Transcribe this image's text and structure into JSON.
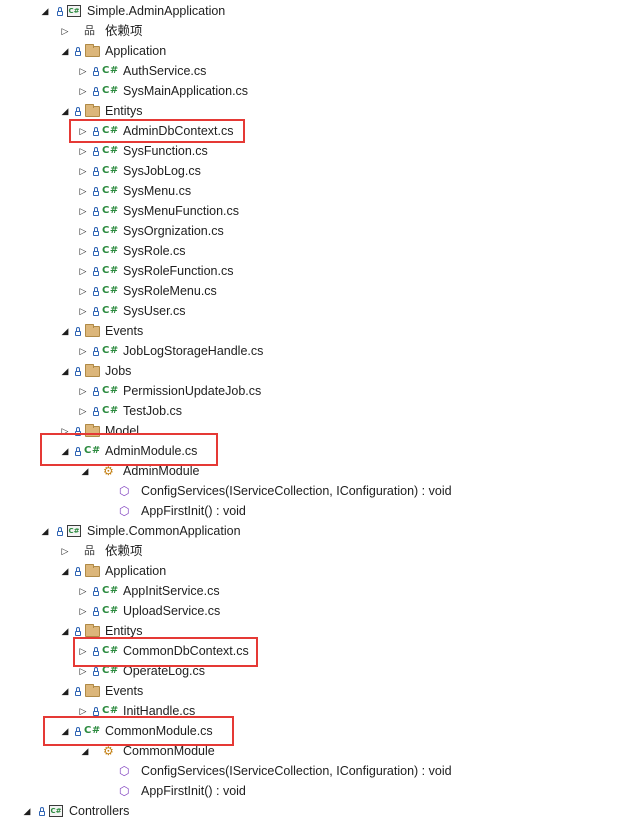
{
  "colors": {
    "highlight": "#e53935",
    "csharp": "#2b8a3e",
    "folder": "#dcb67a",
    "lock": "#2f64b4",
    "method": "#7f3fbf",
    "class": "#c27d0e"
  },
  "tree": {
    "admin_project": "Simple.AdminApplication",
    "admin_deps": "依赖项",
    "admin_application_folder": "Application",
    "auth_service": "AuthService.cs",
    "sys_main_application": "SysMainApplication.cs",
    "admin_entitys_folder": "Entitys",
    "admin_db_context": "AdminDbContext.cs",
    "sys_function": "SysFunction.cs",
    "sys_job_log": "SysJobLog.cs",
    "sys_menu": "SysMenu.cs",
    "sys_menu_function": "SysMenuFunction.cs",
    "sys_orgnization": "SysOrgnization.cs",
    "sys_role": "SysRole.cs",
    "sys_role_function": "SysRoleFunction.cs",
    "sys_role_menu": "SysRoleMenu.cs",
    "sys_user": "SysUser.cs",
    "admin_events_folder": "Events",
    "job_log_storage_handle": "JobLogStorageHandle.cs",
    "jobs_folder": "Jobs",
    "permission_update_job": "PermissionUpdateJob.cs",
    "test_job": "TestJob.cs",
    "model_folder": "Model",
    "admin_module_file": "AdminModule.cs",
    "admin_module_class": "AdminModule",
    "admin_config_services": "ConfigServices(IServiceCollection, IConfiguration) : void",
    "admin_app_first_init": "AppFirstInit() : void",
    "common_project": "Simple.CommonApplication",
    "common_deps": "依赖项",
    "common_application_folder": "Application",
    "app_init_service": "AppInitService.cs",
    "upload_service": "UploadService.cs",
    "common_entitys_folder": "Entitys",
    "common_db_context": "CommonDbContext.cs",
    "operate_log": "OperateLog.cs",
    "common_events_folder": "Events",
    "init_handle": "InitHandle.cs",
    "common_module_file": "CommonModule.cs",
    "common_module_class": "CommonModule",
    "common_config_services": "ConfigServices(IServiceCollection, IConfiguration) : void",
    "common_app_first_init": "AppFirstInit() : void",
    "controllers_project": "Controllers"
  }
}
